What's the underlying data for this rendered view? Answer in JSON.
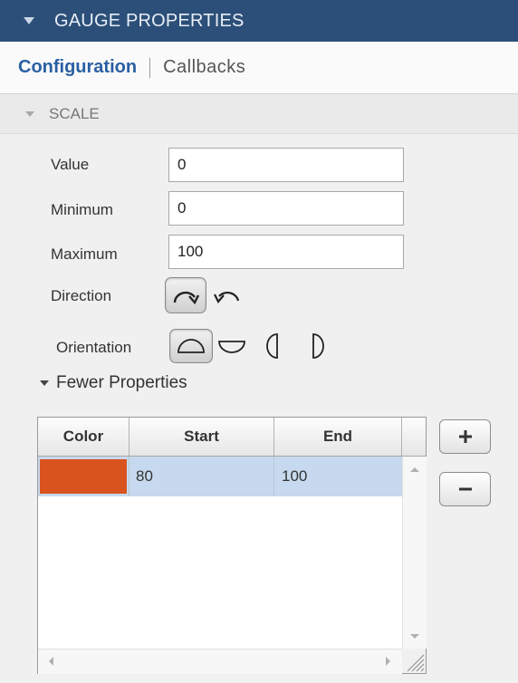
{
  "header": {
    "title": "GAUGE PROPERTIES"
  },
  "tabs": {
    "active": "Configuration",
    "other": "Callbacks"
  },
  "section": {
    "title": "SCALE"
  },
  "fields": {
    "value": {
      "label": "Value",
      "value": "0"
    },
    "minimum": {
      "label": "Minimum",
      "value": "0"
    },
    "maximum": {
      "label": "Maximum",
      "value": "100"
    }
  },
  "direction": {
    "label": "Direction",
    "selected": "clockwise",
    "options": [
      "clockwise-arrow-icon",
      "counterclockwise-arrow-icon"
    ]
  },
  "orientation": {
    "label": "Orientation",
    "selected": "north",
    "options": [
      "north-half-circle-icon",
      "south-half-circle-icon",
      "west-half-circle-icon",
      "east-half-circle-icon"
    ]
  },
  "more_toggle": {
    "label": "Fewer Properties"
  },
  "table": {
    "columns": [
      "Color",
      "Start",
      "End"
    ],
    "rows": [
      {
        "color": "#d9531e",
        "start": "80",
        "end": "100"
      }
    ]
  },
  "buttons": {
    "add": "+",
    "remove": "−"
  },
  "colors": {
    "header_bg": "#2b4f78",
    "accent": "#2a5fa3",
    "row_selected": "#c6d9ee"
  }
}
